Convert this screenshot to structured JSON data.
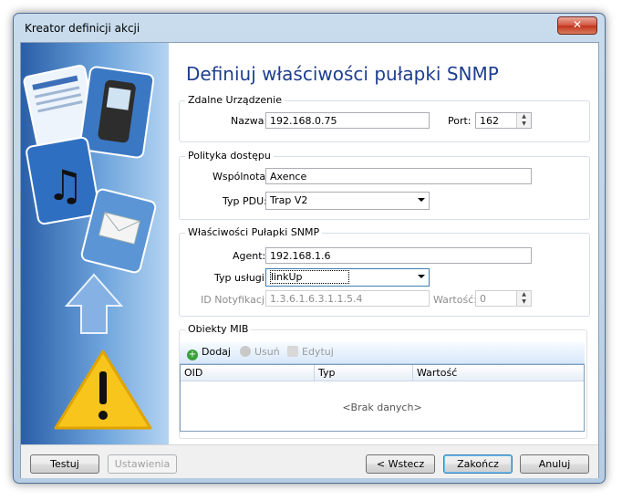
{
  "window": {
    "title": "Kreator definicji akcji",
    "close_glyph": "✕"
  },
  "heading": "Definiuj właściwości pułapki SNMP",
  "remote_device": {
    "title": "Zdalne Urządzenie",
    "name_label": "Nazwa:",
    "name_value": "192.168.0.75",
    "port_label": "Port:",
    "port_value": "162"
  },
  "access_policy": {
    "title": "Polityka dostępu",
    "community_label": "Wspólnota:",
    "community_value": "Axence",
    "pdu_label": "Typ PDU:",
    "pdu_value": "Trap V2"
  },
  "trap_properties": {
    "title": "Właściwości Pułapki SNMP",
    "agent_label": "Agent:",
    "agent_value": "192.168.1.6",
    "service_type_label": "Typ usługi:",
    "service_type_value": "linkUp",
    "notification_id_label": "ID Notyfikacji:",
    "notification_id_value": "1.3.6.1.6.3.1.1.5.4",
    "value_label": "Wartość:",
    "value_value": "0"
  },
  "mib": {
    "title": "Obiekty MIB",
    "add_label": "Dodaj",
    "remove_label": "Usuń",
    "edit_label": "Edytuj",
    "columns": [
      "OID",
      "Typ",
      "Wartość"
    ],
    "empty_text": "<Brak danych>"
  },
  "footer": {
    "test_label": "Testuj",
    "settings_label": "Ustawienia",
    "back_label": "< Wstecz",
    "finish_label": "Zakończ",
    "cancel_label": "Anuluj"
  },
  "spin_up": "▲",
  "spin_down": "▼",
  "colors": {
    "heading": "#1e3f8f",
    "side_panel": "#4a84c9",
    "warning": "#f7c51b",
    "add_icon": "#3aa13a"
  },
  "icons": [
    "mobile-phone-icon",
    "music-note-icon",
    "envelope-icon",
    "document-icon",
    "up-arrow-icon",
    "warning-icon",
    "add-icon",
    "remove-icon",
    "edit-icon"
  ]
}
